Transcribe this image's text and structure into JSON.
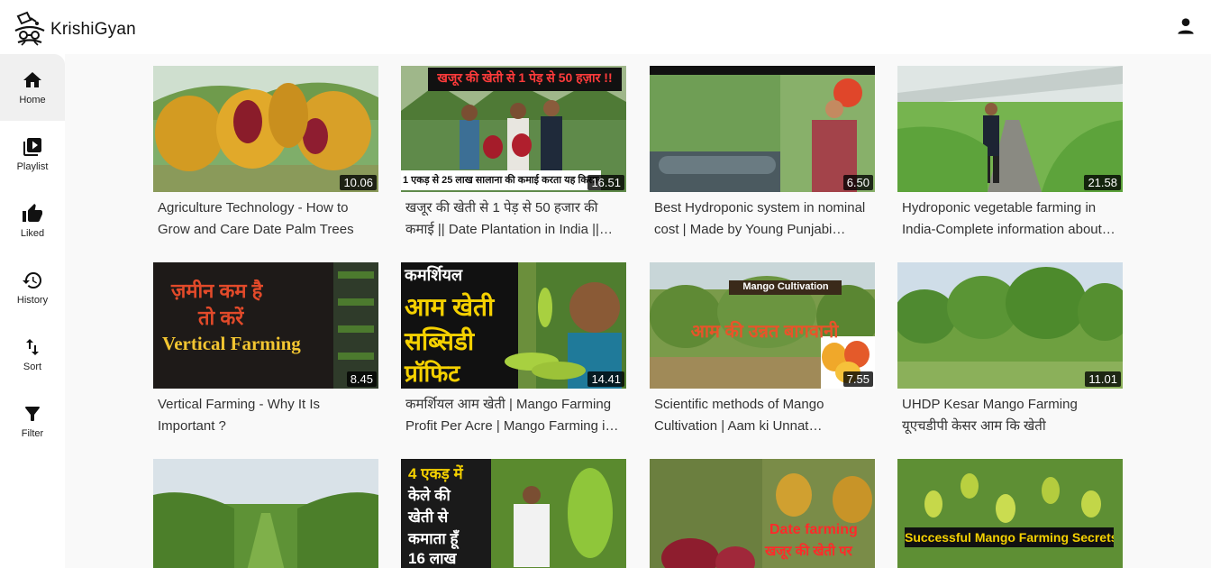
{
  "app": {
    "name": "KrishiGyan"
  },
  "sidebar": {
    "items": [
      {
        "label": "Home",
        "icon": "home-icon"
      },
      {
        "label": "Playlist",
        "icon": "playlist-icon"
      },
      {
        "label": "Liked",
        "icon": "thumbs-up-icon"
      },
      {
        "label": "History",
        "icon": "history-icon"
      },
      {
        "label": "Sort",
        "icon": "sort-icon"
      },
      {
        "label": "Filter",
        "icon": "filter-icon"
      }
    ]
  },
  "videos": [
    {
      "title": "Agriculture Technology - How to Grow and Care Date Palm Trees",
      "duration": "10.06"
    },
    {
      "title": "खजूर की खेती से 1 पेड़ से 50 हजार की कमाई || Date Plantation in India || Date Farming",
      "duration": "16.51",
      "overlay_top": "खजूर की खेती से 1 पेड़ से 50 हज़ार !!",
      "overlay_bottom": "1 एकड़ से 25 लाख सालाना की कमाई करता यह किसान"
    },
    {
      "title": "Best Hydroponic system in nominal cost | Made by Young Punjabi farmer",
      "duration": "6.50"
    },
    {
      "title": "Hydroponic vegetable farming in India-Complete information about hydroponic farming",
      "duration": "21.58"
    },
    {
      "title": "Vertical Farming - Why It Is Important ?",
      "duration": "8.45",
      "overlay_line1": "ज़मीन कम है",
      "overlay_line2": "तो करें",
      "overlay_line3": "Vertical Farming"
    },
    {
      "title": "कमर्शियल आम खेती | Mango Farming Profit Per Acre | Mango Farming in India",
      "duration": "14.41",
      "overlay_line1": "कमर्शियल",
      "overlay_line2": "आम खेती",
      "overlay_line3": "सब्सिडी",
      "overlay_line4": "प्रॉफिट"
    },
    {
      "title": "Scientific methods of Mango Cultivation | Aam ki Unnat Baghwani",
      "duration": "7.55",
      "overlay_line1": "Mango Cultivation",
      "overlay_line2": "आम की उन्नत बागवानी"
    },
    {
      "title": "UHDP Kesar Mango Farming यूएचडीपी केसर आम कि खेती",
      "duration": "11.01"
    },
    {
      "title": "",
      "duration": ""
    },
    {
      "title": "",
      "duration": "",
      "overlay_line1": "4 एकड़ में",
      "overlay_line2": "केले की",
      "overlay_line3": "खेती से",
      "overlay_line4": "कमाता हूँ",
      "overlay_line5": "16 लाख"
    },
    {
      "title": "",
      "duration": "",
      "overlay_line1": "Date farming",
      "overlay_line2": "खजूर की खेती पर"
    },
    {
      "title": "",
      "duration": "",
      "overlay_line1": "Successful Mango Farming Secrets"
    }
  ]
}
